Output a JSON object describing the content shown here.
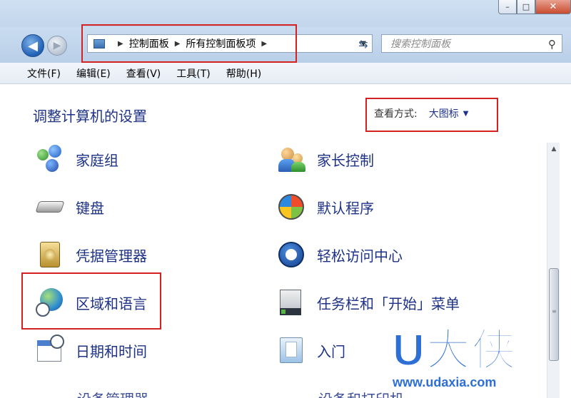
{
  "window": {
    "controls": {
      "minimize": "–",
      "maximize": "□",
      "close": "✕"
    }
  },
  "address": {
    "crumbs": [
      "控制面板",
      "所有控制面板项"
    ],
    "search_placeholder": "搜索控制面板"
  },
  "menu": [
    "文件(F)",
    "编辑(E)",
    "查看(V)",
    "工具(T)",
    "帮助(H)"
  ],
  "content": {
    "heading": "调整计算机的设置",
    "view_by_label": "查看方式:",
    "view_by_value": "大图标"
  },
  "items": [
    {
      "label": "家庭组",
      "icon": "homegroup-icon"
    },
    {
      "label": "家长控制",
      "icon": "parental-controls-icon"
    },
    {
      "label": "键盘",
      "icon": "keyboard-icon"
    },
    {
      "label": "默认程序",
      "icon": "default-programs-icon"
    },
    {
      "label": "凭据管理器",
      "icon": "credential-manager-icon"
    },
    {
      "label": "轻松访问中心",
      "icon": "ease-of-access-icon"
    },
    {
      "label": "区域和语言",
      "icon": "region-language-icon"
    },
    {
      "label": "任务栏和「开始」菜单",
      "icon": "taskbar-start-menu-icon"
    },
    {
      "label": "日期和时间",
      "icon": "date-time-icon"
    },
    {
      "label": "入门",
      "icon": "getting-started-icon"
    }
  ],
  "partial_items": [
    "设备管理器",
    "设备和打印机"
  ],
  "watermark": {
    "logo": "U大侠",
    "url": "www.udaxia.com"
  },
  "colors": {
    "highlight": "#d42121",
    "link": "#1e3287",
    "watermark": "#2e6fd6"
  }
}
